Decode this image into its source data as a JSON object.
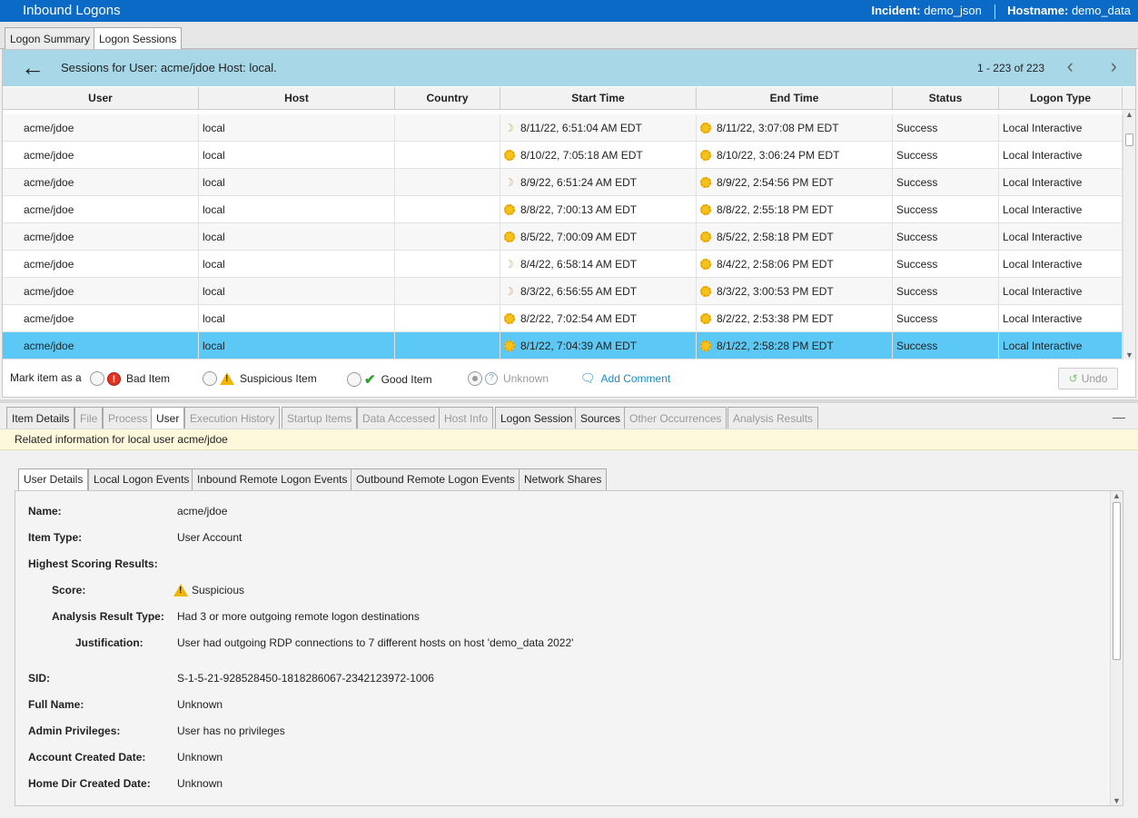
{
  "window": {
    "title": "Inbound Logons",
    "incident_label": "Incident:",
    "incident_value": "demo_json",
    "hostname_label": "Hostname:",
    "hostname_value": "demo_data"
  },
  "top_tabs": [
    {
      "label": "Logon Summary",
      "active": false
    },
    {
      "label": "Logon Sessions",
      "active": true
    }
  ],
  "sessions": {
    "header": "Sessions for User: acme/jdoe Host: local.",
    "page_count": "1 - 223 of 223",
    "columns": [
      "User",
      "Host",
      "Country",
      "Start Time",
      "End Time",
      "Status",
      "Logon Type"
    ],
    "rows": [
      {
        "user": "acme/jdoe",
        "host": "local",
        "country": "",
        "start_icon": "moon-icon",
        "start": "8/11/22, 6:51:04 AM EDT",
        "end_icon": "sun-icon",
        "end": "8/11/22, 3:07:08 PM EDT",
        "status": "Success",
        "type": "Local Interactive"
      },
      {
        "user": "acme/jdoe",
        "host": "local",
        "country": "",
        "start_icon": "sun-icon",
        "start": "8/10/22, 7:05:18 AM EDT",
        "end_icon": "sun-icon",
        "end": "8/10/22, 3:06:24 PM EDT",
        "status": "Success",
        "type": "Local Interactive"
      },
      {
        "user": "acme/jdoe",
        "host": "local",
        "country": "",
        "start_icon": "moon-icon",
        "start": "8/9/22, 6:51:24 AM EDT",
        "end_icon": "sun-icon",
        "end": "8/9/22, 2:54:56 PM EDT",
        "status": "Success",
        "type": "Local Interactive"
      },
      {
        "user": "acme/jdoe",
        "host": "local",
        "country": "",
        "start_icon": "sun-icon",
        "start": "8/8/22, 7:00:13 AM EDT",
        "end_icon": "sun-icon",
        "end": "8/8/22, 2:55:18 PM EDT",
        "status": "Success",
        "type": "Local Interactive"
      },
      {
        "user": "acme/jdoe",
        "host": "local",
        "country": "",
        "start_icon": "sun-icon",
        "start": "8/5/22, 7:00:09 AM EDT",
        "end_icon": "sun-icon",
        "end": "8/5/22, 2:58:18 PM EDT",
        "status": "Success",
        "type": "Local Interactive"
      },
      {
        "user": "acme/jdoe",
        "host": "local",
        "country": "",
        "start_icon": "moon-icon",
        "start": "8/4/22, 6:58:14 AM EDT",
        "end_icon": "sun-icon",
        "end": "8/4/22, 2:58:06 PM EDT",
        "status": "Success",
        "type": "Local Interactive"
      },
      {
        "user": "acme/jdoe",
        "host": "local",
        "country": "",
        "start_icon": "moon-icon",
        "start": "8/3/22, 6:56:55 AM EDT",
        "end_icon": "sun-icon",
        "end": "8/3/22, 3:00:53 PM EDT",
        "status": "Success",
        "type": "Local Interactive"
      },
      {
        "user": "acme/jdoe",
        "host": "local",
        "country": "",
        "start_icon": "sun-icon",
        "start": "8/2/22, 7:02:54 AM EDT",
        "end_icon": "sun-icon",
        "end": "8/2/22, 2:53:38 PM EDT",
        "status": "Success",
        "type": "Local Interactive"
      },
      {
        "user": "acme/jdoe",
        "host": "local",
        "country": "",
        "start_icon": "sun-icon",
        "start": "8/1/22, 7:04:39 AM EDT",
        "end_icon": "sun-icon",
        "end": "8/1/22, 2:58:28 PM EDT",
        "status": "Success",
        "type": "Local Interactive",
        "selected": true
      }
    ]
  },
  "mark": {
    "prefix": "Mark item as a",
    "bad": "Bad Item",
    "suspicious": "Suspicious Item",
    "good": "Good Item",
    "unknown": "Unknown",
    "add_comment": "Add Comment",
    "undo": "Undo"
  },
  "lower_tabs": [
    {
      "label": "Item Details",
      "state": "enabled"
    },
    {
      "label": "File",
      "state": "disabled"
    },
    {
      "label": "Process",
      "state": "disabled"
    },
    {
      "label": "User",
      "state": "active"
    },
    {
      "label": "Execution History",
      "state": "disabled"
    },
    {
      "label": "Startup Items",
      "state": "disabled"
    },
    {
      "label": "Data Accessed",
      "state": "disabled"
    },
    {
      "label": "Host Info",
      "state": "disabled"
    },
    {
      "label": "Logon Session",
      "state": "enabled"
    },
    {
      "label": "Sources",
      "state": "enabled"
    },
    {
      "label": "Other Occurrences",
      "state": "disabled"
    },
    {
      "label": "Analysis Results",
      "state": "disabled"
    }
  ],
  "info_bar": "Related information for local user acme/jdoe",
  "sub_tabs": [
    {
      "label": "User Details",
      "active": true
    },
    {
      "label": "Local Logon Events",
      "active": false
    },
    {
      "label": "Inbound Remote Logon Events",
      "active": false
    },
    {
      "label": "Outbound Remote Logon Events",
      "active": false
    },
    {
      "label": "Network Shares",
      "active": false
    }
  ],
  "details": {
    "name_label": "Name:",
    "name": "acme/jdoe",
    "type_label": "Item Type:",
    "type": "User Account",
    "highest_label": "Highest Scoring Results:",
    "score_label": "Score:",
    "score": "Suspicious",
    "art_label": "Analysis Result Type:",
    "art": "Had 3 or more outgoing remote logon destinations",
    "just_label": "Justification:",
    "just": "User had outgoing RDP connections to 7 different hosts on host 'demo_data 2022'",
    "sid_label": "SID:",
    "sid": "S-1-5-21-928528450-1818286067-2342123972-1006",
    "fullname_label": "Full Name:",
    "fullname": "Unknown",
    "admin_label": "Admin Privileges:",
    "admin": "User has no privileges",
    "created_label": "Account Created Date:",
    "created": "Unknown",
    "homedir_label": "Home Dir Created Date:",
    "homedir": "Unknown"
  }
}
